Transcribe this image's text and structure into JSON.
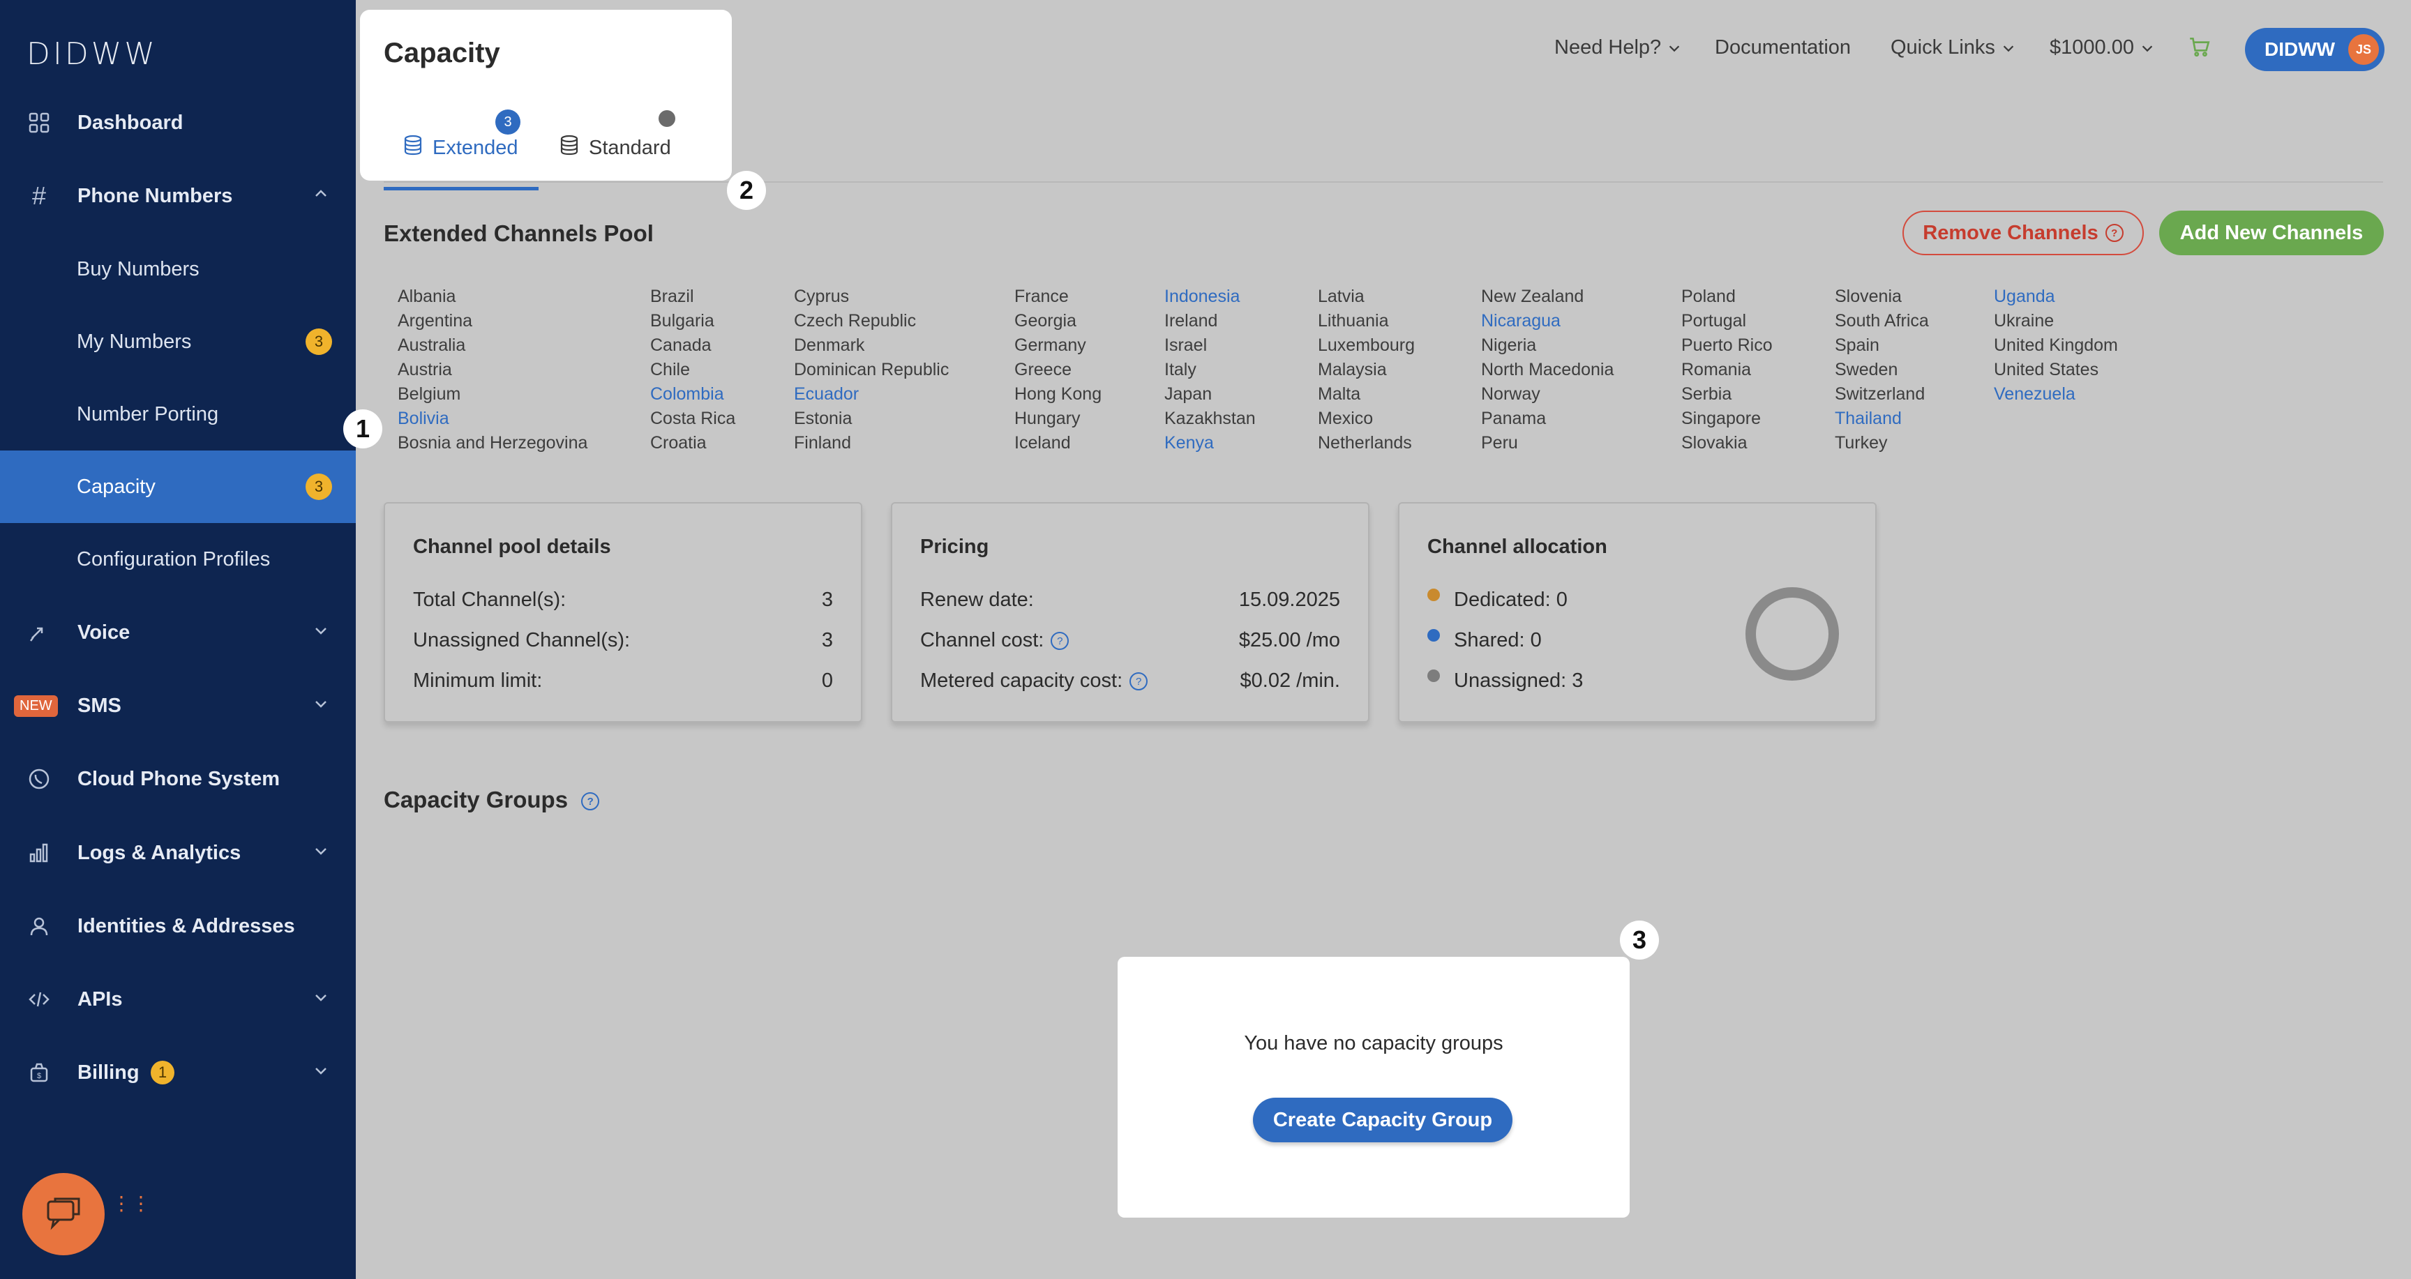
{
  "brand": {
    "logo": "DIDWW"
  },
  "sidebar": {
    "items": [
      {
        "label": "Dashboard"
      },
      {
        "label": "Phone Numbers"
      },
      {
        "label": "Buy Numbers"
      },
      {
        "label": "My Numbers",
        "badge": "3"
      },
      {
        "label": "Number Porting"
      },
      {
        "label": "Capacity",
        "badge": "3"
      },
      {
        "label": "Configuration Profiles"
      },
      {
        "label": "Voice"
      },
      {
        "label": "SMS",
        "tag": "NEW"
      },
      {
        "label": "Cloud Phone System"
      },
      {
        "label": "Logs & Analytics"
      },
      {
        "label": "Identities & Addresses"
      },
      {
        "label": "APIs"
      },
      {
        "label": "Billing",
        "badge": "1"
      }
    ]
  },
  "topbar": {
    "need_help": "Need Help?",
    "documentation": "Documentation",
    "quick_links": "Quick Links",
    "balance": "$1000.00",
    "account": "DIDWW",
    "avatar_initials": "JS"
  },
  "capacity_card": {
    "title": "Capacity",
    "tab_extended": "Extended",
    "tab_extended_badge": "3",
    "tab_standard": "Standard"
  },
  "markers": {
    "m1": "1",
    "m2": "2",
    "m3": "3"
  },
  "pool": {
    "title": "Extended Channels Pool",
    "remove_button": "Remove Channels",
    "add_button": "Add New Channels",
    "countries": [
      [
        "Albania",
        "Argentina",
        "Australia",
        "Austria",
        "Belgium",
        "Bolivia",
        "Bosnia and Herzegovina"
      ],
      [
        "Brazil",
        "Bulgaria",
        "Canada",
        "Chile",
        "Colombia",
        "Costa Rica",
        "Croatia"
      ],
      [
        "Cyprus",
        "Czech Republic",
        "Denmark",
        "Dominican Republic",
        "Ecuador",
        "Estonia",
        "Finland"
      ],
      [
        "France",
        "Georgia",
        "Germany",
        "Greece",
        "Hong Kong",
        "Hungary",
        "Iceland"
      ],
      [
        "Indonesia",
        "Ireland",
        "Israel",
        "Italy",
        "Japan",
        "Kazakhstan",
        "Kenya"
      ],
      [
        "Latvia",
        "Lithuania",
        "Luxembourg",
        "Malaysia",
        "Malta",
        "Mexico",
        "Netherlands"
      ],
      [
        "New Zealand",
        "Nicaragua",
        "Nigeria",
        "North Macedonia",
        "Norway",
        "Panama",
        "Peru"
      ],
      [
        "Poland",
        "Portugal",
        "Puerto Rico",
        "Romania",
        "Serbia",
        "Singapore",
        "Slovakia"
      ],
      [
        "Slovenia",
        "South Africa",
        "Spain",
        "Sweden",
        "Switzerland",
        "Thailand",
        "Turkey"
      ],
      [
        "Uganda",
        "Ukraine",
        "United Kingdom",
        "United States",
        "Venezuela"
      ]
    ],
    "highlighted": [
      "Bolivia",
      "Colombia",
      "Ecuador",
      "Indonesia",
      "Kenya",
      "Nicaragua",
      "Thailand",
      "Uganda",
      "Venezuela"
    ]
  },
  "details": {
    "title": "Channel pool details",
    "rows": [
      {
        "label": "Total Channel(s):",
        "value": "3"
      },
      {
        "label": "Unassigned Channel(s):",
        "value": "3"
      },
      {
        "label": "Minimum limit:",
        "value": "0"
      }
    ]
  },
  "pricing": {
    "title": "Pricing",
    "rows": [
      {
        "label": "Renew date:",
        "value": "15.09.2025"
      },
      {
        "label": "Channel cost:",
        "value": "$25.00 /mo"
      },
      {
        "label": "Metered capacity cost:",
        "value": "$0.02 /min."
      }
    ]
  },
  "allocation": {
    "title": "Channel allocation",
    "items": [
      {
        "label": "Dedicated: 0",
        "color": "#c98a2e"
      },
      {
        "label": "Shared: 0",
        "color": "#2f6bc0"
      },
      {
        "label": "Unassigned: 3",
        "color": "#7d7d7d"
      }
    ]
  },
  "groups": {
    "title": "Capacity Groups",
    "empty_text": "You have no capacity groups",
    "create_button": "Create Capacity Group"
  }
}
